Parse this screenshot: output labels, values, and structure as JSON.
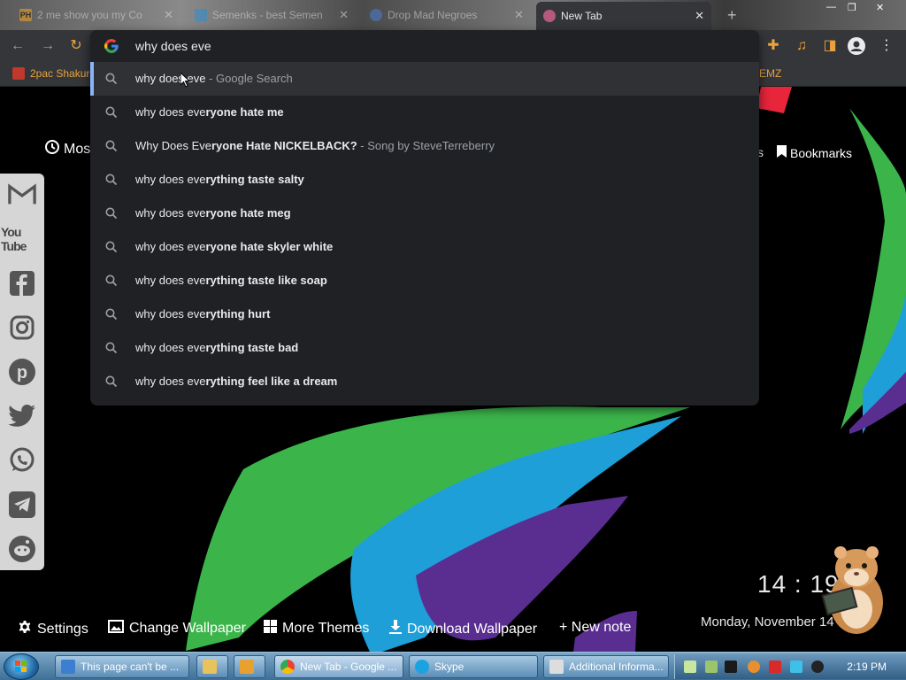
{
  "tabs": [
    {
      "label": "2  me show you my Co"
    },
    {
      "label": "Semenks - best Semen"
    },
    {
      "label": "Drop Mad Negroes"
    },
    {
      "label": "New Tab"
    }
  ],
  "bookmarks": [
    {
      "label": "2pac Shakur"
    },
    {
      "label": "EMZ"
    }
  ],
  "omnibox": {
    "query": "why does eve",
    "suggestions": [
      {
        "typed": "why does eve",
        "rest": "",
        "desc": " - Google Search"
      },
      {
        "typed": "why does eve",
        "rest": "ryone hate me",
        "desc": ""
      },
      {
        "typed": "Why Does Eve",
        "rest": "ryone Hate NICKELBACK?",
        "desc": " - Song by SteveTerreberry"
      },
      {
        "typed": "why does eve",
        "rest": "rything taste salty",
        "desc": ""
      },
      {
        "typed": "why does eve",
        "rest": "ryone hate meg",
        "desc": ""
      },
      {
        "typed": "why does eve",
        "rest": "ryone hate skyler white",
        "desc": ""
      },
      {
        "typed": "why does eve",
        "rest": "rything taste like soap",
        "desc": ""
      },
      {
        "typed": "why does eve",
        "rest": "rything hurt",
        "desc": ""
      },
      {
        "typed": "why does eve",
        "rest": "rything taste bad",
        "desc": ""
      },
      {
        "typed": "why does eve",
        "rest": "rything feel like a dream",
        "desc": ""
      }
    ]
  },
  "ntp": {
    "most_visited": "Mos",
    "tabs_fragment": "s",
    "bookmarks": "Bookmarks",
    "bottom": {
      "settings": "Settings",
      "change_wallpaper": "Change Wallpaper",
      "more_themes": "More Themes",
      "download_wallpaper": "Download Wallpaper",
      "new_note": "+ New note"
    },
    "clock": "14 : 19",
    "date": "Monday, November 14"
  },
  "social": [
    "gmail-icon",
    "youtube-icon",
    "facebook-icon",
    "instagram-icon",
    "pinterest-icon",
    "twitter-icon",
    "whatsapp-icon",
    "telegram-icon",
    "reddit-icon"
  ],
  "social_labels": {
    "youtube": "You Tube"
  },
  "taskbar": {
    "items": [
      {
        "label": "This page can't be ..."
      },
      {
        "label": ""
      },
      {
        "label": ""
      },
      {
        "label": "New Tab - Google ..."
      },
      {
        "label": "Skype"
      },
      {
        "label": "Additional Informa..."
      }
    ],
    "time": "2:19 PM"
  },
  "colors": {
    "omnibox_bg": "#202124",
    "selected_row": "#303134",
    "accent": "#8ab4f8",
    "wall_green": "#3bb54a",
    "wall_blue": "#1e9fd8",
    "wall_purple": "#5a2d91",
    "wall_red": "#e8253a"
  }
}
